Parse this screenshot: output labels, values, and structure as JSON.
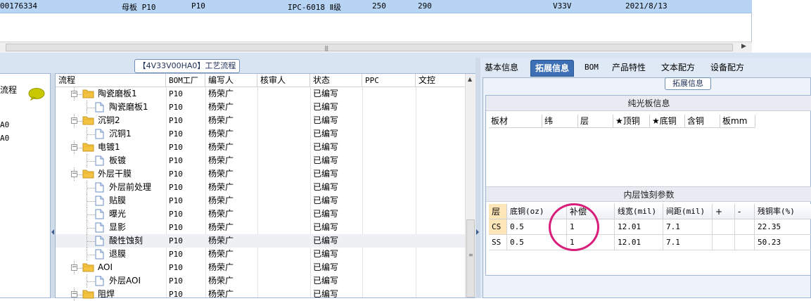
{
  "top_grid": {
    "row": [
      "00176334",
      "母板 P10",
      "P10",
      "IPC-6018 Ⅱ级",
      "250",
      "290",
      "V33V",
      "2021/8/13"
    ],
    "scroll_grip": "|||"
  },
  "process_panel": {
    "legend": "【4V33V00HA0】工艺流程",
    "left_header": "流程",
    "left_items": [
      "A0",
      "A0"
    ],
    "columns": [
      "流程",
      "BOM工厂",
      "编写人",
      "核审人",
      "状态",
      "PPC",
      "文控"
    ],
    "rows": [
      {
        "name": "陶瓷磨板1",
        "level": 1,
        "expanded": true,
        "factory": "P10",
        "writer": "杨荣广",
        "status": "已编写"
      },
      {
        "name": "陶瓷磨板1",
        "level": 2,
        "factory": "P10",
        "writer": "杨荣广",
        "status": "已编写"
      },
      {
        "name": "沉铜2",
        "level": 1,
        "expanded": true,
        "factory": "P10",
        "writer": "杨荣广",
        "status": "已编写"
      },
      {
        "name": "沉铜1",
        "level": 2,
        "factory": "P10",
        "writer": "杨荣广",
        "status": "已编写"
      },
      {
        "name": "电镀1",
        "level": 1,
        "expanded": true,
        "factory": "P10",
        "writer": "杨荣广",
        "status": "已编写"
      },
      {
        "name": "板镀",
        "level": 2,
        "factory": "P10",
        "writer": "杨荣广",
        "status": "已编写"
      },
      {
        "name": "外层干膜",
        "level": 1,
        "expanded": true,
        "factory": "P10",
        "writer": "杨荣广",
        "status": "已编写"
      },
      {
        "name": "外层前处理",
        "level": 2,
        "factory": "P10",
        "writer": "杨荣广",
        "status": "已编写"
      },
      {
        "name": "贴膜",
        "level": 2,
        "factory": "P10",
        "writer": "杨荣广",
        "status": "已编写"
      },
      {
        "name": "曝光",
        "level": 2,
        "factory": "P10",
        "writer": "杨荣广",
        "status": "已编写"
      },
      {
        "name": "显影",
        "level": 2,
        "factory": "P10",
        "writer": "杨荣广",
        "status": "已编写"
      },
      {
        "name": "酸性蚀刻",
        "level": 2,
        "factory": "P10",
        "writer": "杨荣广",
        "status": "已编写",
        "selected": true
      },
      {
        "name": "退膜",
        "level": 2,
        "factory": "P10",
        "writer": "杨荣广",
        "status": "已编写"
      },
      {
        "name": "AOI",
        "level": 1,
        "expanded": true,
        "factory": "P10",
        "writer": "杨荣广",
        "status": "已编写"
      },
      {
        "name": "外层AOI",
        "level": 2,
        "factory": "P10",
        "writer": "杨荣广",
        "status": "已编写"
      },
      {
        "name": "阻焊",
        "level": 1,
        "expanded": true,
        "factory": "P10",
        "writer": "杨荣广",
        "status": "已编写"
      }
    ]
  },
  "tabs": {
    "items": [
      "基本信息",
      "拓展信息",
      "BOM",
      "产品特性",
      "文本配方",
      "设备配方"
    ],
    "active": 1
  },
  "extended_info": {
    "legend": "拓展信息",
    "board_section": {
      "title": "纯光板信息",
      "columns": [
        "板材",
        "纬",
        "层",
        "★顶铜",
        "★底铜",
        "含铜",
        "板mm"
      ]
    },
    "etch_section": {
      "title": "内层蚀刻参数",
      "columns": [
        "层",
        "底铜(oz)",
        "补偿",
        "线宽(mil)",
        "间距(mil)",
        "+",
        "-",
        "残铜率(%)"
      ],
      "rows": [
        [
          "CS",
          "0.5",
          "1",
          "12.01",
          "7.1",
          "",
          "",
          "22.35"
        ],
        [
          "SS",
          "0.5",
          "1",
          "12.01",
          "7.1",
          "",
          "",
          "50.23"
        ]
      ]
    }
  },
  "colors": {
    "accent": "#3c6fb4",
    "selection": "#b8d4f4",
    "annotation": "#d81d7a",
    "folder": "#f5c342"
  }
}
